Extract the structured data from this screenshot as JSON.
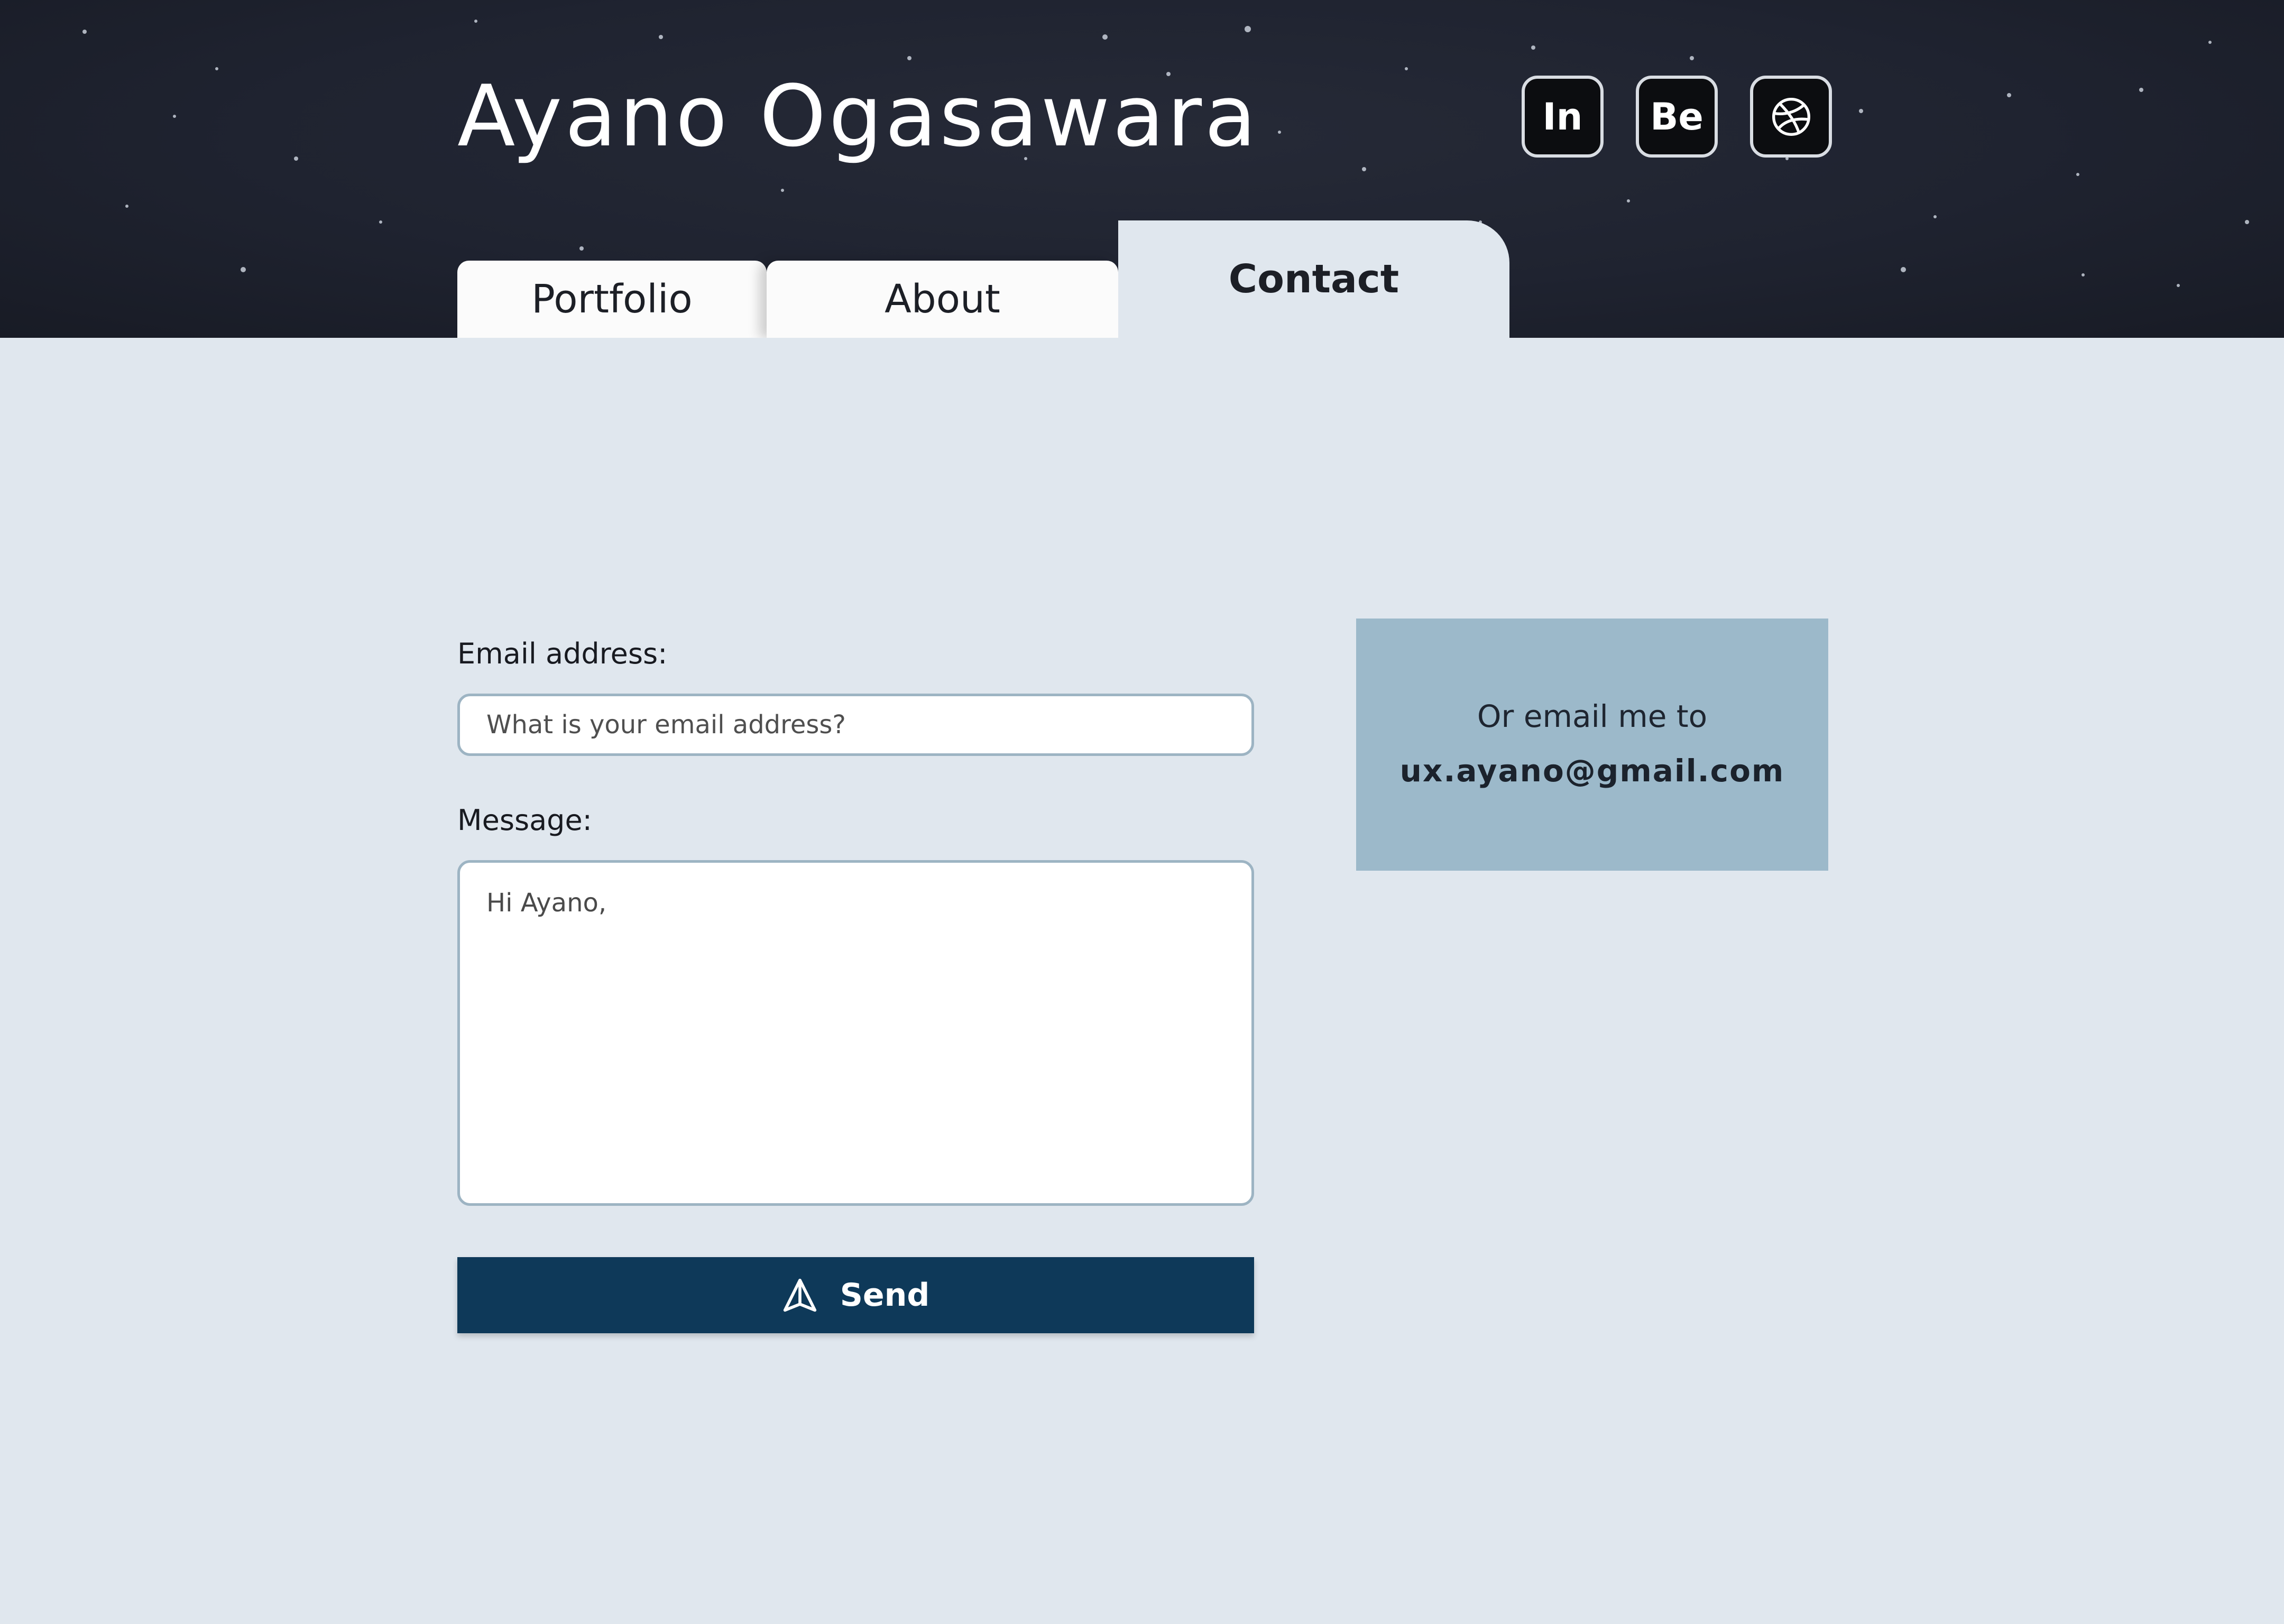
{
  "header": {
    "name": "Ayano Ogasawara",
    "social": [
      {
        "label": "In",
        "icon": "linkedin-icon"
      },
      {
        "label": "Be",
        "icon": "behance-icon"
      },
      {
        "label": "",
        "icon": "dribbble-icon"
      }
    ],
    "tabs": [
      {
        "label": "Portfolio",
        "active": false
      },
      {
        "label": "About",
        "active": false
      },
      {
        "label": "Contact",
        "active": true
      }
    ]
  },
  "form": {
    "email_label": "Email address:",
    "email_placeholder": "What is your email address?",
    "email_value": "",
    "message_label": "Message:",
    "message_value": "Hi Ayano,",
    "send_label": "Send",
    "send_icon": "paper-plane-icon"
  },
  "aside": {
    "prompt": "Or email me to",
    "email": "ux.ayano@gmail.com"
  },
  "colors": {
    "header_bg": "#1f2330",
    "page_bg": "#e0e7ee",
    "accent": "#0e3959",
    "aside_bg": "#9cb9ca",
    "field_border": "#9db4c3"
  }
}
